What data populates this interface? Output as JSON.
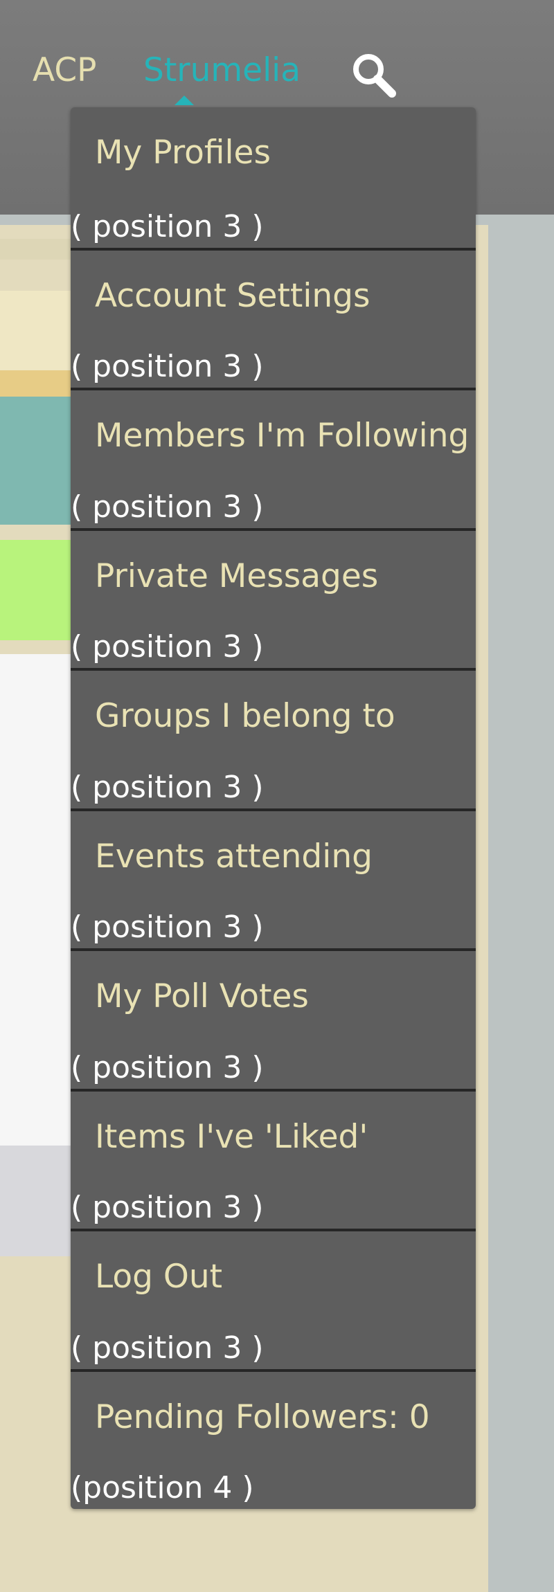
{
  "nav": {
    "acp_label": "ACP",
    "username": "Strumelia",
    "search_icon": "search-icon",
    "accent_color": "#26b4b9"
  },
  "menu": {
    "items": [
      {
        "label": "My Profiles",
        "note": "( position 3 )"
      },
      {
        "label": "Account Settings",
        "note": "( position 3 )"
      },
      {
        "label": "Members I'm Following",
        "note": "( position 3 )"
      },
      {
        "label": "Private Messages",
        "note": "( position 3 )"
      },
      {
        "label": "Groups I belong to",
        "note": "( position 3 )"
      },
      {
        "label": "Events attending",
        "note": "( position 3 )"
      },
      {
        "label": "My Poll Votes",
        "note": "( position 3 )"
      },
      {
        "label": "Items I've 'Liked'",
        "note": "( position 3 )"
      },
      {
        "label": "Log Out",
        "note": "( position 3 )"
      },
      {
        "label": "Pending Followers: 0",
        "note": "(position 4 )"
      }
    ]
  }
}
